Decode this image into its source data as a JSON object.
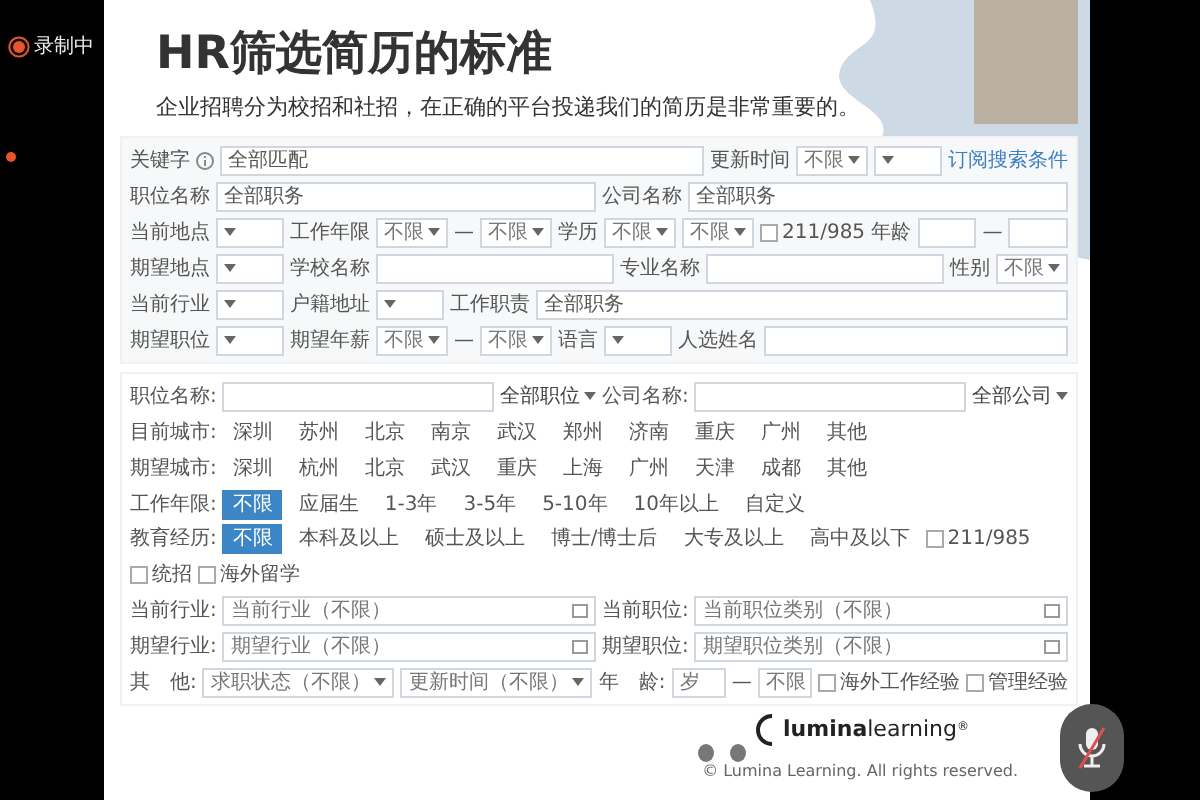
{
  "recording": {
    "label": "录制中"
  },
  "slide": {
    "title": "HR筛选简历的标准",
    "subtitle": "企业招聘分为校招和社招，在正确的平台投递我们的简历是非常重要的。"
  },
  "form_1": {
    "lines": [
      {
        "items": [
          {
            "kind": "label",
            "text": "关键字"
          },
          {
            "kind": "info"
          },
          {
            "kind": "field",
            "prefix": "全部匹配"
          },
          {
            "kind": "label",
            "text": "更新时间"
          },
          {
            "kind": "select",
            "value": "不限"
          },
          {
            "kind": "select"
          },
          {
            "kind": "link",
            "text": "订阅搜索条件"
          }
        ]
      },
      {
        "items": [
          {
            "kind": "label",
            "text": "职位名称"
          },
          {
            "kind": "field",
            "prefix": "全部职务"
          },
          {
            "kind": "label",
            "text": "公司名称"
          },
          {
            "kind": "field",
            "prefix": "全部职务"
          }
        ]
      },
      {
        "items": [
          {
            "kind": "label",
            "text": "当前地点"
          },
          {
            "kind": "select"
          },
          {
            "kind": "label",
            "text": "工作年限"
          },
          {
            "kind": "select",
            "value": "不限"
          },
          {
            "kind": "dash",
            "text": "—"
          },
          {
            "kind": "select",
            "value": "不限"
          },
          {
            "kind": "label",
            "text": "学历"
          },
          {
            "kind": "select",
            "value": "不限"
          },
          {
            "kind": "select",
            "value": "不限"
          },
          {
            "kind": "checkbox",
            "text": "211/985",
            "checked": false
          },
          {
            "kind": "label",
            "text": "年龄"
          },
          {
            "kind": "field"
          },
          {
            "kind": "dash",
            "text": "—"
          },
          {
            "kind": "field"
          }
        ]
      },
      {
        "items": [
          {
            "kind": "label",
            "text": "期望地点"
          },
          {
            "kind": "select"
          },
          {
            "kind": "label",
            "text": "学校名称"
          },
          {
            "kind": "field"
          },
          {
            "kind": "label",
            "text": "专业名称"
          },
          {
            "kind": "field"
          },
          {
            "kind": "label",
            "text": "性别"
          },
          {
            "kind": "select",
            "value": "不限"
          }
        ]
      },
      {
        "items": [
          {
            "kind": "label",
            "text": "当前行业"
          },
          {
            "kind": "select"
          },
          {
            "kind": "label",
            "text": "户籍地址"
          },
          {
            "kind": "select"
          },
          {
            "kind": "label",
            "text": "工作职责"
          },
          {
            "kind": "field",
            "prefix": "全部职务"
          }
        ]
      },
      {
        "items": [
          {
            "kind": "label",
            "text": "期望职位"
          },
          {
            "kind": "select"
          },
          {
            "kind": "label",
            "text": "期望年薪"
          },
          {
            "kind": "select",
            "value": "不限"
          },
          {
            "kind": "dash",
            "text": "—"
          },
          {
            "kind": "select",
            "value": "不限"
          },
          {
            "kind": "label",
            "text": "语言"
          },
          {
            "kind": "select"
          },
          {
            "kind": "label",
            "text": "人选姓名"
          },
          {
            "kind": "field"
          }
        ]
      }
    ]
  },
  "form_2": {
    "lines": [
      {
        "items": [
          {
            "kind": "label",
            "text": "职位名称:"
          },
          {
            "kind": "field"
          },
          {
            "kind": "menu",
            "text": "全部职位"
          },
          {
            "kind": "label",
            "text": "公司名称:"
          },
          {
            "kind": "field"
          },
          {
            "kind": "menu",
            "text": "全部公司"
          }
        ]
      },
      {
        "items": [
          {
            "kind": "label",
            "text": "目前城市:"
          },
          {
            "kind": "chip",
            "text": "深圳",
            "selected": false
          },
          {
            "kind": "chip",
            "text": "苏州",
            "selected": false
          },
          {
            "kind": "chip",
            "text": "北京",
            "selected": false
          },
          {
            "kind": "chip",
            "text": "南京",
            "selected": false
          },
          {
            "kind": "chip",
            "text": "武汉",
            "selected": false
          },
          {
            "kind": "chip",
            "text": "郑州",
            "selected": false
          },
          {
            "kind": "chip",
            "text": "济南",
            "selected": false
          },
          {
            "kind": "chip",
            "text": "重庆",
            "selected": false
          },
          {
            "kind": "chip",
            "text": "广州",
            "selected": false
          },
          {
            "kind": "chip",
            "text": "其他",
            "selected": false
          }
        ]
      },
      {
        "items": [
          {
            "kind": "label",
            "text": "期望城市:"
          },
          {
            "kind": "chip",
            "text": "深圳",
            "selected": false
          },
          {
            "kind": "chip",
            "text": "杭州",
            "selected": false
          },
          {
            "kind": "chip",
            "text": "北京",
            "selected": false
          },
          {
            "kind": "chip",
            "text": "武汉",
            "selected": false
          },
          {
            "kind": "chip",
            "text": "重庆",
            "selected": false
          },
          {
            "kind": "chip",
            "text": "上海",
            "selected": false
          },
          {
            "kind": "chip",
            "text": "广州",
            "selected": false
          },
          {
            "kind": "chip",
            "text": "天津",
            "selected": false
          },
          {
            "kind": "chip",
            "text": "成都",
            "selected": false
          },
          {
            "kind": "chip",
            "text": "其他",
            "selected": false
          }
        ]
      },
      {
        "items": [
          {
            "kind": "label",
            "text": "工作年限:"
          },
          {
            "kind": "chip",
            "text": "不限",
            "selected": true
          },
          {
            "kind": "chip",
            "text": "应届生",
            "selected": false
          },
          {
            "kind": "chip",
            "text": "1-3年",
            "selected": false
          },
          {
            "kind": "chip",
            "text": "3-5年",
            "selected": false
          },
          {
            "kind": "chip",
            "text": "5-10年",
            "selected": false
          },
          {
            "kind": "chip",
            "text": "10年以上",
            "selected": false
          },
          {
            "kind": "chip",
            "text": "自定义",
            "selected": false
          }
        ]
      },
      {
        "items": [
          {
            "kind": "label",
            "text": "教育经历:"
          },
          {
            "kind": "chip",
            "text": "不限",
            "selected": true
          },
          {
            "kind": "chip",
            "text": "本科及以上",
            "selected": false
          },
          {
            "kind": "chip",
            "text": "硕士及以上",
            "selected": false
          },
          {
            "kind": "chip",
            "text": "博士/博士后",
            "selected": false
          },
          {
            "kind": "chip",
            "text": "大专及以上",
            "selected": false
          },
          {
            "kind": "chip",
            "text": "高中及以下",
            "selected": false
          },
          {
            "kind": "checkbox",
            "text": "211/985",
            "checked": false
          },
          {
            "kind": "checkbox",
            "text": "统招",
            "checked": false
          },
          {
            "kind": "checkbox",
            "text": "海外留学",
            "checked": false
          }
        ]
      },
      {
        "items": [
          {
            "kind": "label",
            "text": "当前行业:"
          },
          {
            "kind": "picker",
            "value": "当前行业（不限）"
          },
          {
            "kind": "label",
            "text": "当前职位:"
          },
          {
            "kind": "picker",
            "value": "当前职位类别（不限）"
          }
        ]
      },
      {
        "items": [
          {
            "kind": "label",
            "text": "期望行业:"
          },
          {
            "kind": "picker",
            "value": "期望行业（不限）"
          },
          {
            "kind": "label",
            "text": "期望职位:"
          },
          {
            "kind": "picker",
            "value": "期望职位类别（不限）"
          }
        ]
      },
      {
        "items": [
          {
            "kind": "label",
            "text": "其　他:"
          },
          {
            "kind": "select",
            "value": "求职状态（不限）"
          },
          {
            "kind": "select",
            "value": "更新时间（不限）"
          },
          {
            "kind": "label",
            "text": "年　龄:"
          },
          {
            "kind": "field",
            "value": "岁"
          },
          {
            "kind": "dash",
            "text": "—"
          },
          {
            "kind": "field",
            "value": "不限"
          },
          {
            "kind": "checkbox",
            "text": "海外工作经验",
            "checked": false
          },
          {
            "kind": "checkbox",
            "text": "管理经验",
            "checked": false
          }
        ]
      }
    ]
  },
  "logo": {
    "bold": "lumina",
    "light": "learning",
    "mark": "®"
  },
  "copyright": "© Lumina Learning. All rights reserved."
}
